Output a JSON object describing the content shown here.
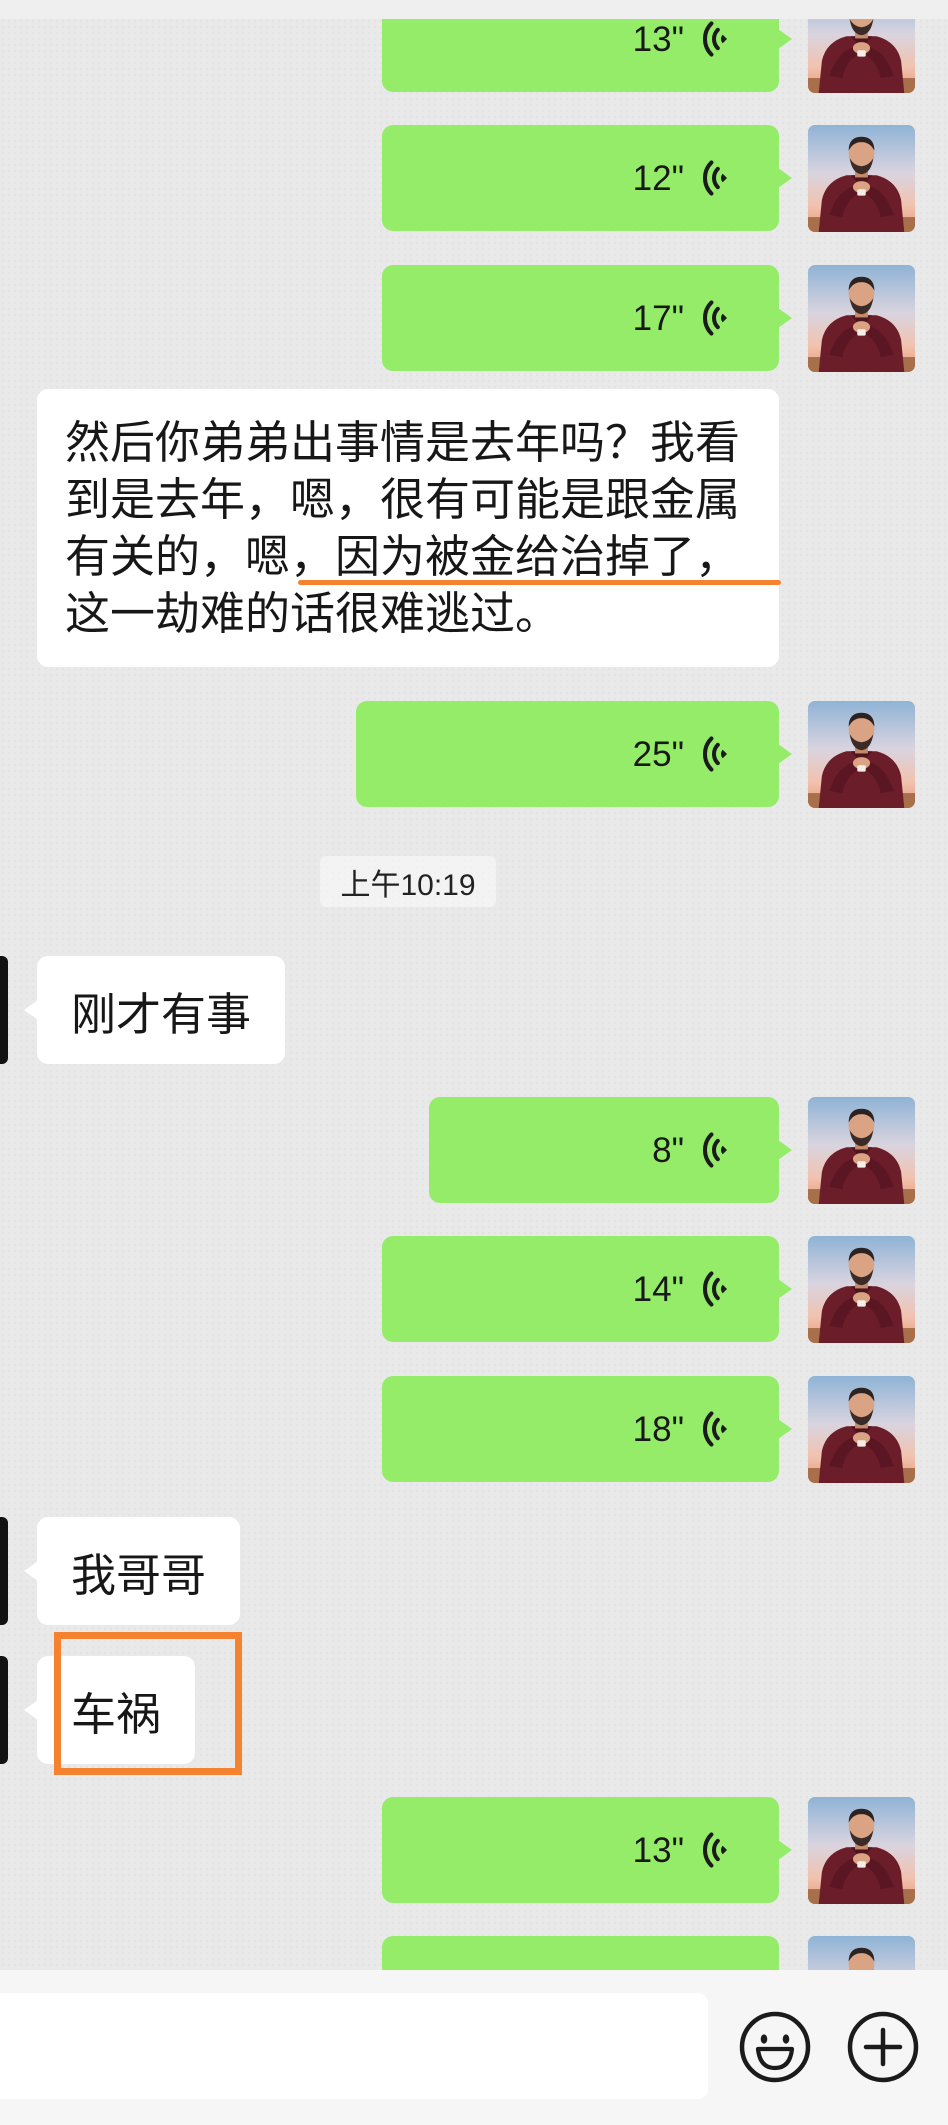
{
  "colors": {
    "chat_background": "#e9e9e9",
    "sent_bubble": "#95ec69",
    "received_bubble": "#ffffff",
    "annotation": "#f5822f"
  },
  "messages": [
    {
      "sent_voice": "13\""
    },
    {
      "sent_voice": "12\""
    },
    {
      "sent_voice": "17\""
    },
    {
      "received_text": "然后你弟弟出事情是去年吗？我看到是去年，嗯，很有可能是跟金属有关的，嗯，因为被金给治掉了，这一劫难的话很难逃过。"
    },
    {
      "sent_voice": "25\""
    },
    {
      "time": "上午10:19"
    },
    {
      "received_text": "刚才有事"
    },
    {
      "sent_voice": "8\""
    },
    {
      "sent_voice": "14\""
    },
    {
      "sent_voice": "18\""
    },
    {
      "received_text": "我哥哥"
    },
    {
      "received_text": "车祸"
    },
    {
      "sent_voice": "13\""
    }
  ],
  "icons": {
    "voice": "voice-wave-icon",
    "emoji": "emoji-icon",
    "more": "plus-circle-icon"
  }
}
